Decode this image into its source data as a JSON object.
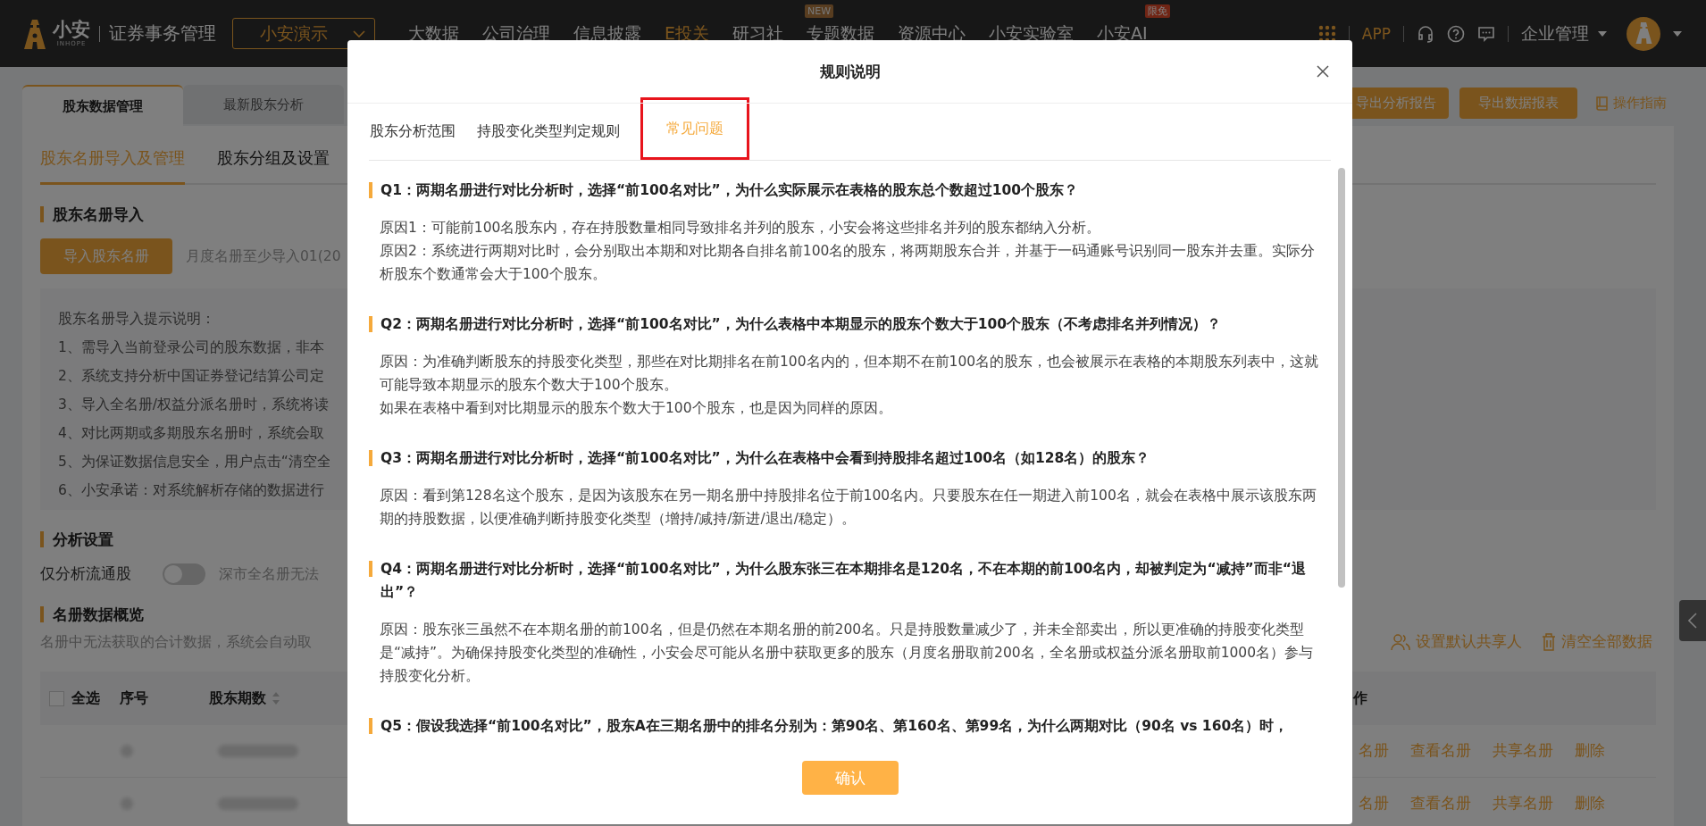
{
  "nav": {
    "brand": "小安",
    "brand_sub": "INHOPE",
    "product": "证券事务管理",
    "company": "小安演示",
    "menu": [
      {
        "label": "大数据",
        "selected": false
      },
      {
        "label": "公司治理",
        "selected": false
      },
      {
        "label": "信息披露",
        "selected": false
      },
      {
        "label": "E投关",
        "selected": true
      },
      {
        "label": "研习社",
        "selected": false
      },
      {
        "label": "专题数据",
        "selected": false,
        "badge": "NEW"
      },
      {
        "label": "资源中心",
        "selected": false
      },
      {
        "label": "小安实验室",
        "selected": false
      },
      {
        "label": "小安AI",
        "selected": false,
        "badge": "限免"
      }
    ],
    "app": "APP",
    "account": "企业管理"
  },
  "page_tabs": [
    {
      "label": "股东数据管理",
      "selected": true
    },
    {
      "label": "最新股东分析",
      "selected": false
    }
  ],
  "sub_tabs": [
    {
      "label": "股东名册导入及管理",
      "selected": true
    },
    {
      "label": "股东分组及设置",
      "selected": false
    }
  ],
  "actions": [
    "导出分析报告",
    "导出数据报表"
  ],
  "guide": "操作指南",
  "import_section": {
    "title": "股东名册导入",
    "button": "导入股东名册",
    "hint": "月度名册至少导入01(20",
    "notes": [
      "股东名册导入提示说明：",
      "1、需导入当前登录公司的股东数据，非本",
      "2、系统支持分析中国证券登记结算公司定",
      "3、导入全名册/权益分派名册时，系统将读",
      "4、对比两期或多期股东名册时，系统会取",
      "5、为保证数据信息安全，用户点击“清空全",
      "6、小安承诺：对系统解析存储的数据进行"
    ]
  },
  "analysis_section": {
    "title": "分析设置",
    "toggle": {
      "label": "仅分析流通股",
      "on": false
    },
    "hint": "深市全名册无法"
  },
  "overview_section": {
    "title": "名册数据概览",
    "note": "名册中无法获取的合计数据，系统会自动取",
    "links": [
      "设置默认共享人",
      "清空全部数据"
    ]
  },
  "table": {
    "select_all": false,
    "columns": [
      "全选",
      "序号",
      "股东期数",
      "作"
    ],
    "rows": [
      {
        "actions": [
          "名册",
          "查看名册",
          "共享名册",
          "删除"
        ]
      },
      {
        "actions": [
          "名册",
          "查看名册",
          "共享名册",
          "删除"
        ]
      }
    ]
  },
  "modal": {
    "title": "规则说明",
    "tabs": [
      {
        "label": "股东分析范围",
        "selected": false,
        "highlighted": false
      },
      {
        "label": "持股变化类型判定规则",
        "selected": false,
        "highlighted": false
      },
      {
        "label": "常见问题",
        "selected": true,
        "highlighted": true
      }
    ],
    "faq": [
      {
        "question": "Q1：两期名册进行对比分析时，选择“前100名对比”，为什么实际展示在表格的股东总个数超过100个股东？",
        "answer": [
          "原因1：可能前100名股东内，存在持股数量相同导致排名并列的股东，小安会将这些排名并列的股东都纳入分析。",
          "原因2：系统进行两期对比时，会分别取出本期和对比期各自排名前100名的股东，将两期股东合并，并基于一码通账号识别同一股东并去重。实际分析股东个数通常会大于100个股东。"
        ]
      },
      {
        "question": "Q2：两期名册进行对比分析时，选择“前100名对比”，为什么表格中本期显示的股东个数大于100个股东（不考虑排名并列情况）？",
        "answer": [
          "原因：为准确判断股东的持股变化类型，那些在对比期排名在前100名内的，但本期不在前100名的股东，也会被展示在表格的本期股东列表中，这就可能导致本期显示的股东个数大于100个股东。",
          "如果在表格中看到对比期显示的股东个数大于100个股东，也是因为同样的原因。"
        ]
      },
      {
        "question": "Q3：两期名册进行对比分析时，选择“前100名对比”，为什么在表格中会看到持股排名超过100名（如128名）的股东？",
        "answer": [
          "原因：看到第128名这个股东，是因为该股东在另一期名册中持股排名位于前100名内。只要股东在任一期进入前100名，就会在表格中展示该股东两期的持股数据，以便准确判断持股变化类型（增持/减持/新进/退出/稳定）。"
        ]
      },
      {
        "question": "Q4：两期名册进行对比分析时，选择“前100名对比”，为什么股东张三在本期排名是120名，不在本期的前100名内，却被判定为“减持”而非“退出”？",
        "answer": [
          "原因：股东张三虽然不在本期名册的前100名，但是仍然在本期名册的前200名。只是持股数量减少了，并未全部卖出，所以更准确的持股变化类型是“减持”。为确保持股变化类型的准确性，小安会尽可能从名册中获取更多的股东（月度名册取前200名，全名册或权益分派名册取前1000名）参与持股变化分析。"
        ]
      },
      {
        "question": "Q5：假设我选择“前100名对比”，股东A在三期名册中的排名分别为：第90名、第160名、第99名，为什么两期对比（90名 vs 160名）时，"
      }
    ],
    "confirm": "确认"
  }
}
